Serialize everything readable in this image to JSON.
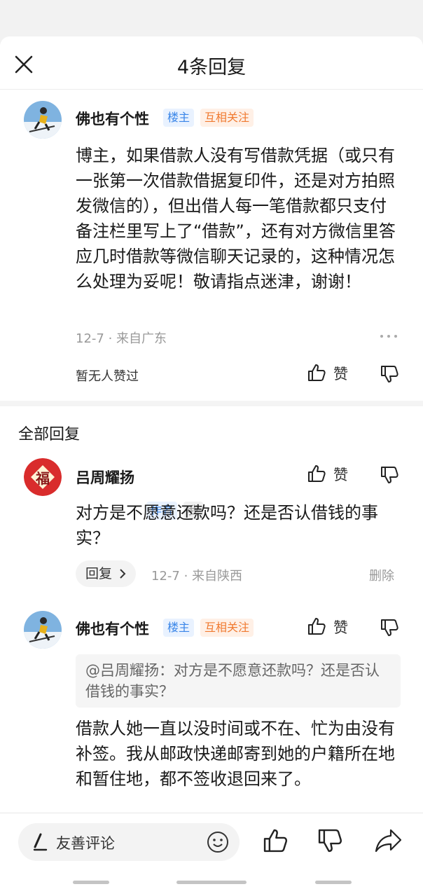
{
  "header": {
    "title": "4条回复"
  },
  "main_comment": {
    "username": "佛也有个性",
    "tags": [
      "楼主",
      "互相关注"
    ],
    "text": "博主，如果借款人没有写借款凭据（或只有一张第一次借款借据复印件，还是对方拍照发微信的），但出借人每一笔借款都只支付备注栏里写上了“借款”，还有对方微信里答应几时借款等微信聊天记录的，这种情况怎么处理为妥呢！敬请指点迷津，谢谢！",
    "meta": "12-7 · 来自广东",
    "likes_text": "暂无人赞过",
    "like_label": "赞"
  },
  "section": {
    "title": "全部回复"
  },
  "replies": [
    {
      "username": "吕周耀扬",
      "tags": [
        "作者",
        "我"
      ],
      "text": "对方是不愿意还款吗？还是否认借钱的事实？",
      "reply_button": "回复",
      "meta": "12-7 · 来自陕西",
      "delete_label": "删除",
      "like_label": "赞",
      "avatar_char": "福"
    },
    {
      "username": "佛也有个性",
      "tags": [
        "楼主",
        "互相关注"
      ],
      "quote": "@吕周耀扬：对方是不愿意还款吗？还是否认借钱的事实？",
      "text": "借款人她一直以没时间或不在、忙为由没有补签。我从邮政快递邮寄到她的户籍所在地和暂住地，都不签收退回来了。",
      "like_label": "赞"
    }
  ],
  "bottom_bar": {
    "input_placeholder": "友善评论"
  },
  "colors": {
    "tag_blue": "#3a86e8",
    "tag_orange": "#f07a30",
    "avatar_red": "#d92c2c"
  }
}
